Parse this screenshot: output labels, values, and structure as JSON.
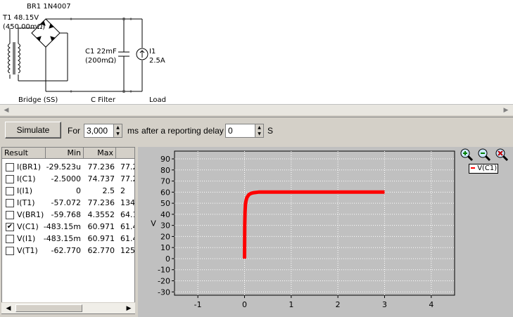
{
  "schematic": {
    "bridge_label": "BR1 1N4007",
    "transformer_label": "T1 48.15V",
    "transformer_res": "(450.00mΩ)",
    "cap_label": "C1 22mF",
    "cap_res": "(200mΩ)",
    "load_label": "I1",
    "load_value": "2.5A",
    "sections": [
      "Bridge (SS)",
      "C Filter",
      "Load"
    ]
  },
  "controls": {
    "simulate_label": "Simulate",
    "for_label": "For",
    "duration_value": "3,000",
    "duration_unit": "ms",
    "delay_label": "after a reporting delay of",
    "delay_value": "0",
    "delay_unit": "S"
  },
  "results": {
    "columns": [
      "Result",
      "Min",
      "Max",
      "D"
    ],
    "rows": [
      {
        "name": "I(BR1)",
        "min": "-29.523u",
        "max": "77.236",
        "d": "77.2",
        "checked": false
      },
      {
        "name": "I(C1)",
        "min": "-2.5000",
        "max": "74.737",
        "d": "77.2",
        "checked": false
      },
      {
        "name": "I(I1)",
        "min": "0",
        "max": "2.5",
        "d": "2",
        "checked": false
      },
      {
        "name": "I(T1)",
        "min": "-57.072",
        "max": "77.236",
        "d": "134.",
        "checked": false
      },
      {
        "name": "V(BR1)",
        "min": "-59.768",
        "max": "4.3552",
        "d": "64.1",
        "checked": false
      },
      {
        "name": "V(C1)",
        "min": "-483.15m",
        "max": "60.971",
        "d": "61.4",
        "checked": true
      },
      {
        "name": "V(I1)",
        "min": "-483.15m",
        "max": "60.971",
        "d": "61.4",
        "checked": false
      },
      {
        "name": "V(T1)",
        "min": "-62.770",
        "max": "62.770",
        "d": "125.",
        "checked": false
      }
    ]
  },
  "legend": {
    "entry": "V(C1)",
    "color": "#ff0000"
  },
  "chart_data": {
    "type": "line",
    "ylabel": "V",
    "xlim": [
      -1.5,
      4.5
    ],
    "ylim": [
      -33,
      97
    ],
    "xticks": [
      -1,
      0,
      1,
      2,
      3,
      4
    ],
    "yticks": [
      90,
      80,
      70,
      60,
      50,
      40,
      30,
      20,
      10,
      0,
      -10,
      -20,
      -30
    ],
    "grid": true,
    "series": [
      {
        "name": "V(C1)",
        "color": "#ff0000",
        "x": [
          0,
          0.005,
          0.01,
          0.02,
          0.03,
          0.05,
          0.08,
          0.1,
          0.15,
          0.2,
          0.3,
          0.5,
          1,
          2,
          3
        ],
        "y": [
          0,
          30,
          42,
          49,
          52,
          55,
          57,
          58,
          59,
          59.5,
          60,
          60,
          60,
          60,
          60
        ]
      }
    ]
  }
}
